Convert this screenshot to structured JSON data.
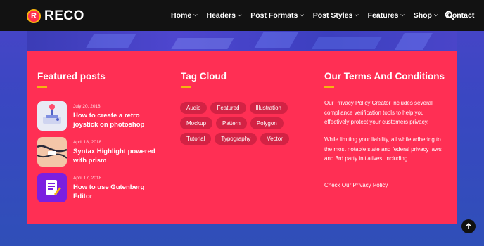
{
  "brand": {
    "logo_letter": "R",
    "name": "RECO"
  },
  "nav": {
    "items": [
      {
        "label": "Home",
        "has_dropdown": true
      },
      {
        "label": "Headers",
        "has_dropdown": true
      },
      {
        "label": "Post Formats",
        "has_dropdown": true
      },
      {
        "label": "Post Styles",
        "has_dropdown": true
      },
      {
        "label": "Features",
        "has_dropdown": true
      },
      {
        "label": "Shop",
        "has_dropdown": true
      },
      {
        "label": "Contact",
        "has_dropdown": false
      }
    ],
    "search_icon": "search-icon"
  },
  "featured": {
    "title": "Featured posts",
    "posts": [
      {
        "date": "July 20, 2018",
        "title": "How to create a retro joystick on photoshop",
        "thumb": "joystick-illustration"
      },
      {
        "date": "April 18, 2018",
        "title": "Syntax Highlight powered with prism",
        "thumb": "cable-illustration"
      },
      {
        "date": "April 17, 2018",
        "title": "How to use Gutenberg Editor",
        "thumb": "editor-illustration"
      }
    ]
  },
  "tag_cloud": {
    "title": "Tag Cloud",
    "tags": [
      "Audio",
      "Featured",
      "Illustration",
      "Mockup",
      "Pattern",
      "Polygon",
      "Tutorial",
      "Typography",
      "Vector"
    ]
  },
  "terms": {
    "title": "Our Terms And Conditions",
    "paragraph1": "Our Privacy Policy Creator includes several compliance verification tools to help you effectively protect your customers privacy.",
    "paragraph2": "While limiting your liability, all while adhering to the most notable state and federal privacy laws and 3rd party initiatives, including.",
    "link": "Check Our Privacy Policy"
  },
  "colors": {
    "nav_bg": "#121212",
    "card_bg": "#ff2f54",
    "accent": "#f6b40f",
    "tag_bg": "#d32244"
  },
  "back_to_top_icon": "arrow-up-icon"
}
